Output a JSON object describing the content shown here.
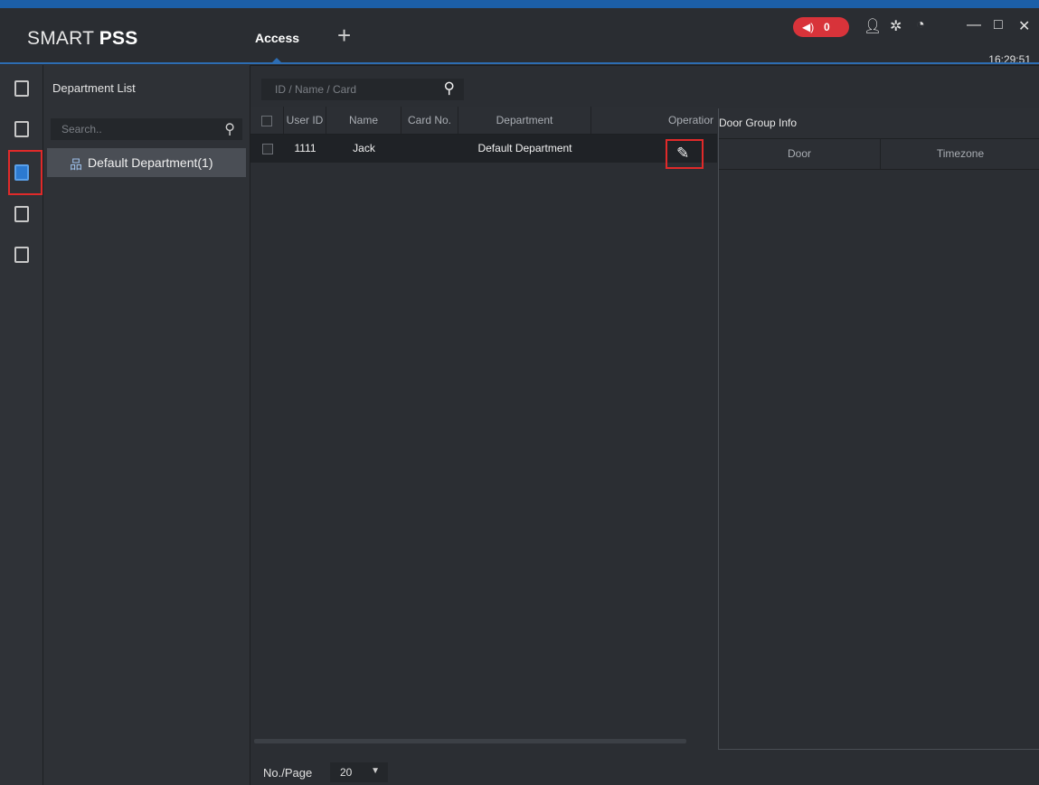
{
  "app": {
    "brand_prefix": "SMART ",
    "brand_bold": "PSS",
    "clock": "16:29:51"
  },
  "tabs": [
    {
      "label": "Access"
    }
  ],
  "add_tab_glyph": "+",
  "alarm": {
    "count": "0",
    "icon": "speaker-icon",
    "color": "#d8333a"
  },
  "toolbar_icons": {
    "user": "user-icon",
    "settings": "gear-icon",
    "perf": "gauge-icon"
  },
  "window_controls": {
    "minimize": "—",
    "maximize": "□",
    "close": "✕"
  },
  "sidebar_nav": [
    {
      "name": "device-access-icon"
    },
    {
      "name": "person-card-icon"
    },
    {
      "name": "user-lock-icon",
      "active": true
    },
    {
      "name": "document-icon"
    },
    {
      "name": "calendar-icon"
    }
  ],
  "department_panel": {
    "title": "Department List",
    "search_placeholder": "Search..",
    "tree": [
      {
        "label": "Default Department(1)"
      }
    ]
  },
  "main": {
    "search_placeholder": "ID / Name / Card",
    "columns": [
      "User ID",
      "Name",
      "Card No.",
      "Department",
      "Operatior"
    ],
    "rows": [
      {
        "user_id": "1111",
        "name": "Jack",
        "card_no": "",
        "department": "Default Department"
      }
    ],
    "footer": {
      "label": "No./Page",
      "page_size": "20"
    }
  },
  "door_group": {
    "title": "Door Group Info",
    "columns": [
      "Door",
      "Timezone"
    ]
  },
  "accent_colors": {
    "highlight_red": "#e02a2a",
    "tab_blue": "#2d6db3"
  }
}
